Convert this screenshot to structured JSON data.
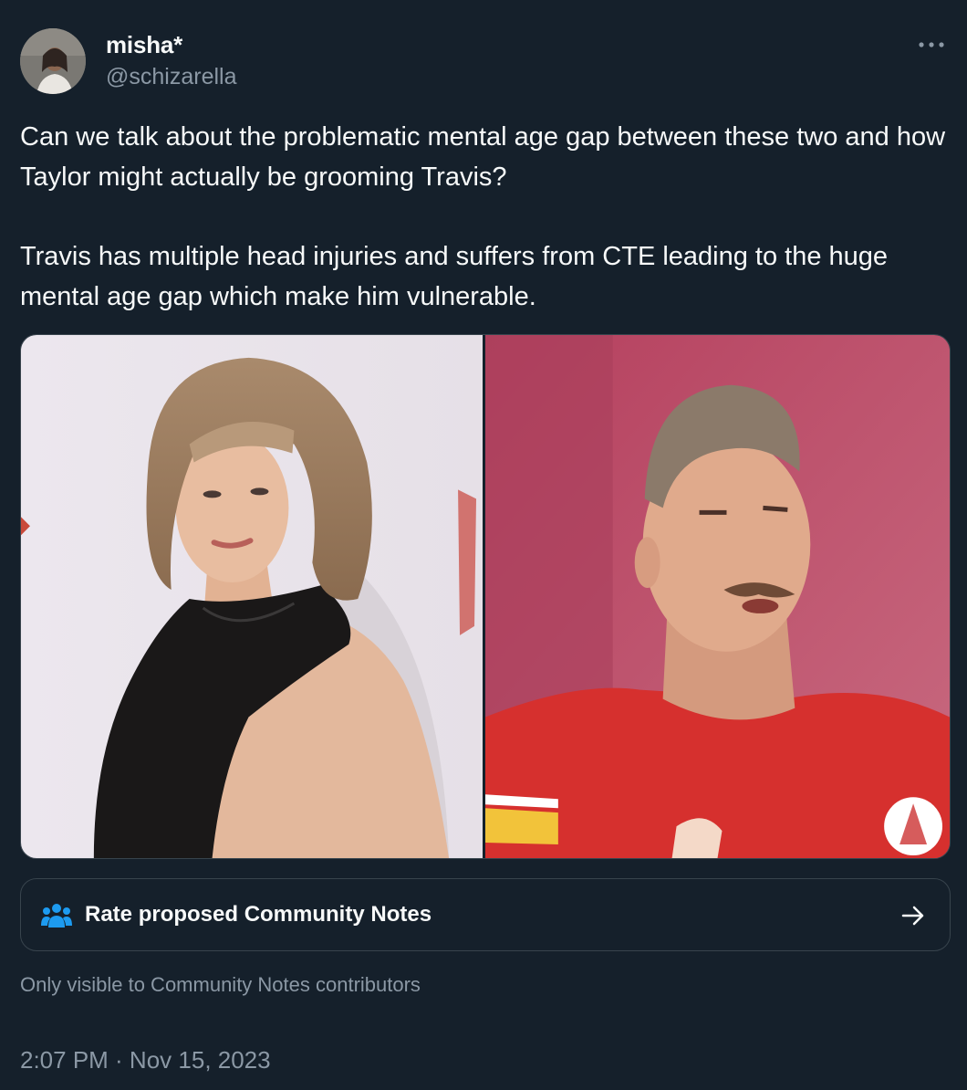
{
  "author": {
    "display_name": "misha*",
    "handle": "@schizarella",
    "avatar_icon": "user-avatar"
  },
  "menu": {
    "icon": "more-icon"
  },
  "tweet": {
    "paragraphs": [
      "Can we talk about the problematic mental age gap between these two and how Taylor might actually be grooming Travis?",
      "Travis has multiple head injuries and suffers from CTE leading to the huge mental age gap which make him vulnerable."
    ]
  },
  "media": {
    "photos": [
      {
        "subject": "woman with bob haircut in black sequined halter top"
      },
      {
        "subject": "football player in red jersey"
      }
    ]
  },
  "community_notes": {
    "label": "Rate proposed Community Notes",
    "icon": "people-icon",
    "arrow_icon": "arrow-right-icon",
    "visibility": "Only visible to Community Notes contributors"
  },
  "timestamp": "2:07 PM · Nov 15, 2023",
  "colors": {
    "background": "#15202b",
    "text": "#f7f9f9",
    "secondary_text": "#8b98a5",
    "border": "#38444d",
    "notes_icon": "#1d9bf0"
  }
}
